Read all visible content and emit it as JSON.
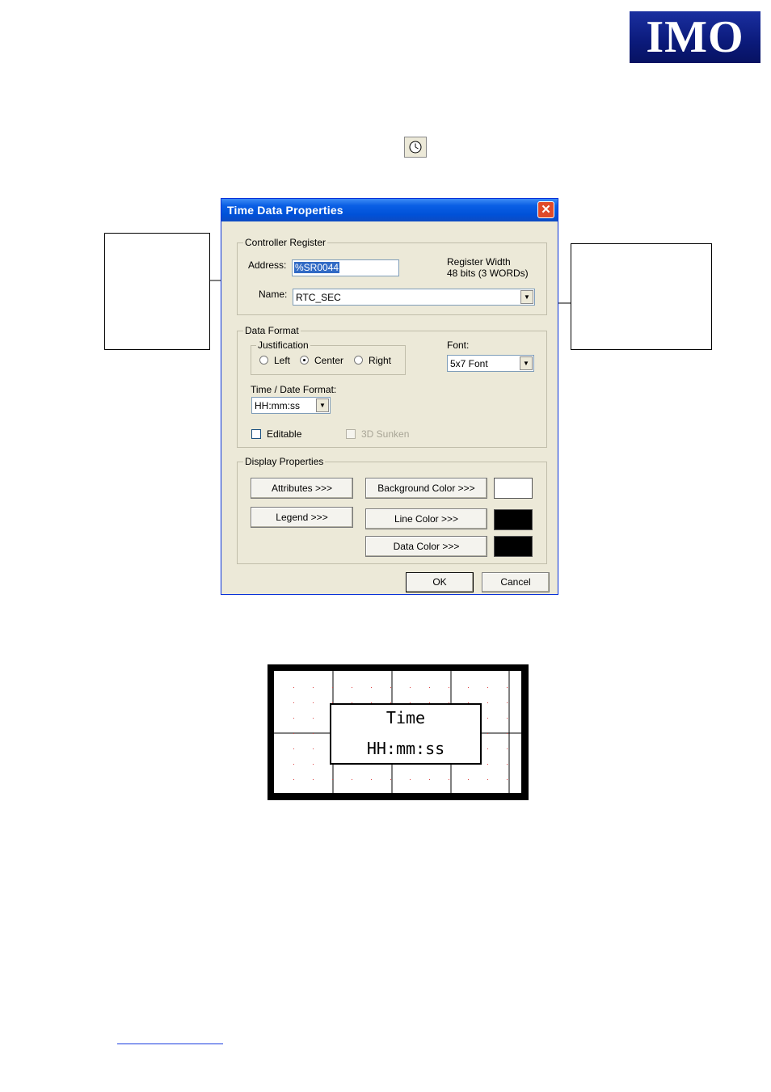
{
  "logo": {
    "text": "IMO"
  },
  "dialog": {
    "title": "Time Data Properties",
    "close_glyph": "✕",
    "controller_register": {
      "group_label": "Controller Register",
      "address_label": "Address:",
      "address_value": "%SR0044",
      "register_width_label": "Register Width",
      "register_width_value": "48 bits (3 WORDs)",
      "name_label": "Name:",
      "name_value": "RTC_SEC"
    },
    "data_format": {
      "group_label": "Data Format",
      "justification_label": "Justification",
      "options": [
        "Left",
        "Center",
        "Right"
      ],
      "selected": "Center",
      "font_label": "Font:",
      "font_value": "5x7 Font",
      "time_date_format_label": "Time / Date Format:",
      "time_date_format_value": "HH:mm:ss",
      "editable_label": "Editable",
      "sunken_label": "3D Sunken"
    },
    "display_properties": {
      "group_label": "Display Properties",
      "attributes_button": "Attributes >>>",
      "legend_button": "Legend >>>",
      "background_color_button": "Background Color >>>",
      "line_color_button": "Line Color >>>",
      "data_color_button": "Data Color >>>",
      "background_color": "#ffffff",
      "line_color": "#000000",
      "data_color": "#000000"
    },
    "ok_button": "OK",
    "cancel_button": "Cancel"
  },
  "preview": {
    "legend": "Time",
    "value": "HH:mm:ss"
  },
  "icons": {
    "toolbar_button": "clock-icon",
    "combo_arrow": "▼"
  }
}
